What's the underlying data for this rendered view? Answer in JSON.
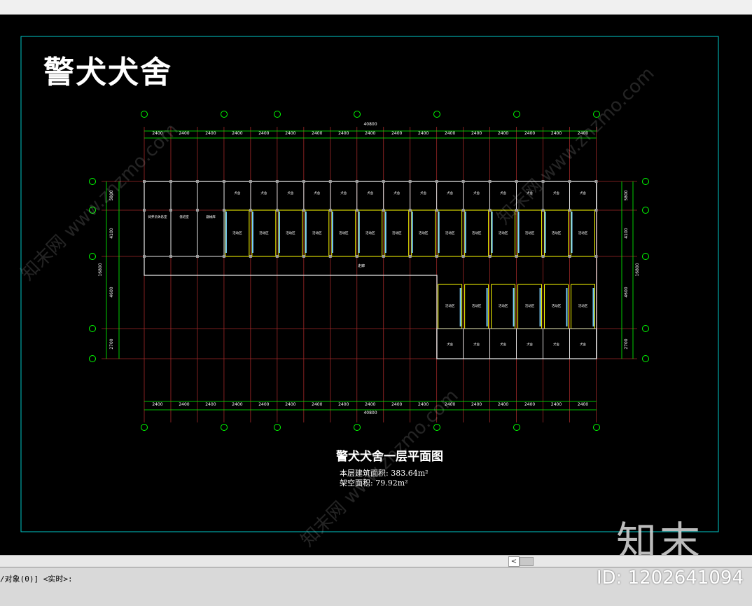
{
  "drawing": {
    "title": "警犬犬舍",
    "plan_title": "警犬犬舍一层平面图",
    "area_note_1": "本层建筑面积: 383.64m²",
    "area_note_2": "架空面积: 79.92m²",
    "corridor_label": "走廊",
    "dim_total": "40800",
    "dim_bay": "2400",
    "dim_rows": [
      "5800",
      "4100",
      "4600",
      "2700"
    ],
    "dim_overall_depth": "16800",
    "room_label_kennel": "犬舍",
    "room_label_yard": "活动区",
    "room_labels_left": [
      "饲养员休息室",
      "值班室",
      "器械库"
    ]
  },
  "watermark": {
    "text": "知末网 www.znzmo.com",
    "brand": "知末"
  },
  "scrollbar": {
    "left_arrow": "<"
  },
  "command": {
    "text": "/对象(0)] <实时>:"
  },
  "image_id": "ID: 1202641094",
  "colors": {
    "canvas": "#000000",
    "border": "#00c8c8",
    "axis": "#00ff00",
    "wall": "#ffff00",
    "grid": "#c03030"
  }
}
